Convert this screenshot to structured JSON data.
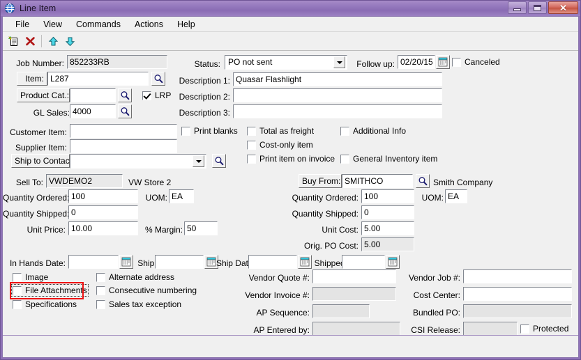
{
  "window": {
    "title": "Line Item",
    "app_icon": "globe-icon",
    "controls": {
      "minimize": "minimize-button",
      "maximize": "maximize-button",
      "close": "close-button",
      "close_glyph": "✕"
    },
    "colors": {
      "titlebar": "#8f72b8",
      "frame": "#8a74ad",
      "face": "#f0f0f0",
      "field": "#ffffff",
      "readonly_field": "#e9e9e9",
      "highlight_annotation": "#ee1111"
    }
  },
  "menubar": {
    "items": [
      {
        "label": "File"
      },
      {
        "label": "View"
      },
      {
        "label": "Commands"
      },
      {
        "label": "Actions"
      },
      {
        "label": "Help"
      }
    ]
  },
  "toolbar": {
    "buttons": [
      {
        "name": "new-record-button",
        "icon": "new-document-icon"
      },
      {
        "name": "delete-record-button",
        "icon": "red-x-delete-icon"
      },
      {
        "name": "move-up-button",
        "icon": "up-arrow-icon"
      },
      {
        "name": "move-down-button",
        "icon": "down-arrow-icon"
      }
    ]
  },
  "form": {
    "job_number": {
      "label": "Job Number:",
      "value": "852233RB",
      "readonly": true
    },
    "item": {
      "label": "Item:",
      "value": "L287",
      "lookup": "magnifier-icon"
    },
    "product_cat": {
      "label": "Product Cat.:",
      "value": "",
      "lookup": "magnifier-icon"
    },
    "lrp": {
      "label": "LRP",
      "checked": true
    },
    "gl_sales": {
      "label": "GL Sales:",
      "value": "4000",
      "lookup": "magnifier-icon"
    },
    "status": {
      "label": "Status:",
      "value": "PO not sent"
    },
    "follow_up": {
      "label": "Follow up:",
      "value": "02/20/15",
      "icon": "calendar-icon"
    },
    "canceled": {
      "label": "Canceled",
      "checked": false
    },
    "description_1": {
      "label": "Description 1:",
      "value": "Quasar Flashlight"
    },
    "description_2": {
      "label": "Description 2:",
      "value": ""
    },
    "description_3": {
      "label": "Description 3:",
      "value": ""
    },
    "customer_item": {
      "label": "Customer Item:",
      "value": ""
    },
    "supplier_item": {
      "label": "Supplier Item:",
      "value": ""
    },
    "ship_to_contact": {
      "label": "Ship to Contact:",
      "value": "",
      "lookup": "magnifier-icon"
    },
    "option_checkboxes": [
      {
        "label": "Print blanks",
        "checked": false,
        "name": "print-blanks"
      },
      {
        "label": "Total as freight",
        "checked": false,
        "name": "total-as-freight"
      },
      {
        "label": "Additional Info",
        "checked": false,
        "name": "additional-info"
      },
      {
        "label": "Cost-only item",
        "checked": false,
        "name": "cost-only-item"
      },
      {
        "label": "Print item on invoice",
        "checked": false,
        "name": "print-item-on-invoice"
      },
      {
        "label": "General Inventory item",
        "checked": false,
        "name": "general-inventory-item"
      }
    ],
    "sell_to": {
      "label": "Sell To:",
      "value": "VWDEMO2",
      "company": "VW Store 2",
      "quantity_ordered": {
        "label": "Quantity Ordered:",
        "value": "100"
      },
      "uom": {
        "label": "UOM:",
        "value": "EA"
      },
      "quantity_shipped": {
        "label": "Quantity Shipped:",
        "value": "0"
      },
      "unit_price": {
        "label": "Unit Price:",
        "value": "10.00"
      },
      "margin": {
        "label": "% Margin:",
        "value": "50"
      }
    },
    "buy_from": {
      "label": "Buy From:",
      "value": "SMITHCO",
      "company": "Smith Company",
      "lookup": "magnifier-icon",
      "quantity_ordered": {
        "label": "Quantity Ordered:",
        "value": "100"
      },
      "uom": {
        "label": "UOM:",
        "value": "EA"
      },
      "quantity_shipped": {
        "label": "Quantity Shipped:",
        "value": "0"
      },
      "unit_cost": {
        "label": "Unit Cost:",
        "value": "5.00"
      },
      "orig_po_cost": {
        "label": "Orig. PO Cost:",
        "value": "5.00",
        "readonly": true
      }
    },
    "dates": [
      {
        "label": "In Hands Date:",
        "value": "",
        "name": "in-hands-date"
      },
      {
        "label": "Ship By:",
        "value": "",
        "name": "ship-by-date"
      },
      {
        "label": "Ship Date:",
        "value": "",
        "name": "ship-date"
      },
      {
        "label": "Shipped:",
        "value": "",
        "name": "shipped-date"
      }
    ],
    "bottom_checkboxes_left": [
      {
        "label": "Image",
        "checked": false,
        "name": "image",
        "highlighted": false
      },
      {
        "label": "File Attachments",
        "checked": false,
        "name": "file-attachments",
        "highlighted": true
      },
      {
        "label": "Specifications",
        "checked": false,
        "name": "specifications",
        "highlighted": false
      }
    ],
    "bottom_checkboxes_right": [
      {
        "label": "Alternate address",
        "checked": false,
        "name": "alternate-address"
      },
      {
        "label": "Consecutive numbering",
        "checked": false,
        "name": "consecutive-numbering"
      },
      {
        "label": "Sales tax exception",
        "checked": false,
        "name": "sales-tax-exception"
      }
    ],
    "vendor_fields": [
      {
        "label": "Vendor Quote #:",
        "value": "",
        "readonly": false,
        "name": "vendor-quote-number"
      },
      {
        "label": "Vendor Invoice #:",
        "value": "",
        "readonly": true,
        "name": "vendor-invoice-number"
      },
      {
        "label": "AP Sequence:",
        "value": "",
        "readonly": true,
        "name": "ap-sequence"
      },
      {
        "label": "AP Entered by:",
        "value": "",
        "readonly": true,
        "name": "ap-entered-by"
      }
    ],
    "right_fields": [
      {
        "label": "Vendor Job #:",
        "value": "",
        "readonly": false,
        "name": "vendor-job-number"
      },
      {
        "label": "Cost Center:",
        "value": "",
        "readonly": false,
        "name": "cost-center"
      },
      {
        "label": "Bundled PO:",
        "value": "",
        "readonly": true,
        "name": "bundled-po"
      },
      {
        "label": "CSI Release:",
        "value": "",
        "readonly": true,
        "name": "csi-release"
      }
    ],
    "protected": {
      "label": "Protected",
      "checked": false
    }
  }
}
